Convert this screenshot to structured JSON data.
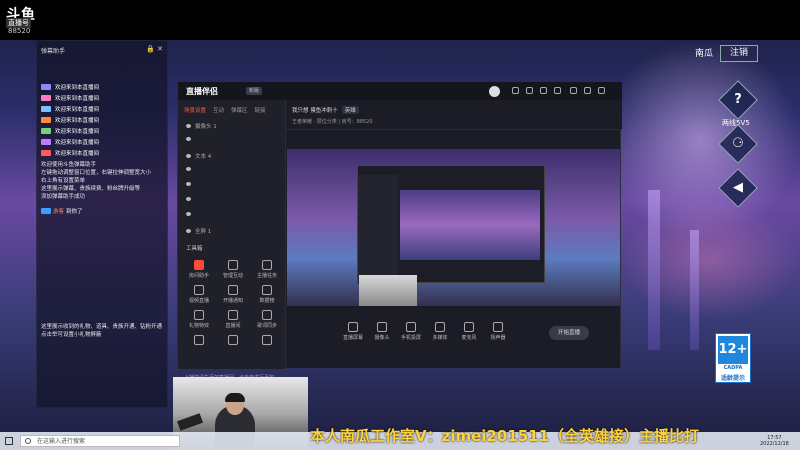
{
  "brand": {
    "logo": "斗鱼",
    "sub": "直播号",
    "room_id": "88520"
  },
  "chat": {
    "title": "弹幕助手",
    "rows": [
      {
        "tag": "#8a8aff",
        "user": "",
        "msg": "欢迎来到本直播间"
      },
      {
        "tag": "#ff7ac0",
        "user": "",
        "msg": "欢迎来到本直播间"
      },
      {
        "tag": "#7ac0ff",
        "user": "",
        "msg": "欢迎来到本直播间"
      },
      {
        "tag": "#ff8a3d",
        "user": "",
        "msg": "欢迎来到本直播间"
      },
      {
        "tag": "#7ad07a",
        "user": "",
        "msg": "欢迎来到本直播间"
      },
      {
        "tag": "#c07aff",
        "user": "",
        "msg": "欢迎来到本直播间"
      },
      {
        "tag": "#ff5a5a",
        "user": "",
        "msg": "欢迎来到本直播间"
      }
    ],
    "system": [
      "欢迎使用斗鱼弹幕助手",
      "左键拖动调整窗口位置，右键拉伸调整宽大小",
      "右上角有设置菜单",
      "这里展示弹幕、贵族续费、粉丝牌升级等",
      "添加弹幕助手成功"
    ],
    "last_user": "游客",
    "last_msg": "到你了",
    "footer": [
      "这里展示收到的礼物、道具、贵族开通、钻粉开通",
      "点击举可设置小礼物屏蔽"
    ]
  },
  "obs": {
    "title": "直播伴侣",
    "badge": "新版",
    "tabs": [
      "场景设置",
      "互动",
      "弹幕区",
      "链接"
    ],
    "sources": [
      "摄像头 1",
      "",
      "文本 4",
      "",
      "",
      "",
      "",
      "全屏 1"
    ],
    "tools_title": "工具箱",
    "tools": [
      "房间助手",
      "管理互动",
      "主播任务",
      "视频直播",
      "开播通知",
      "数据榜",
      "礼物特效",
      "直播间",
      "歌词同步",
      "",
      "",
      ""
    ],
    "warn": "上播前请先添加直播间，点击去进行添加",
    "room_title": "我只想 摸鱼冲刺十",
    "room_tag": "英雄",
    "room_sub": "王者荣耀 · 层位分类  |  房号：88520",
    "bottom": [
      "直播屏幕",
      "摄像头",
      "手机投屏",
      "多媒体",
      "麦克风",
      "扬声器"
    ],
    "go_live": "开始直播"
  },
  "right": {
    "label": "南瓜",
    "logout": "注销",
    "mode": "两线5V5"
  },
  "cadpa": {
    "age": "12+",
    "brand": "CADPA",
    "note": "适龄提示"
  },
  "scroller": "本人南瓜工作室V：zimei201511（全英雄接）主播比打",
  "taskbar": {
    "search": "在这输入进行搜索",
    "time": "17:57",
    "date": "2022/12/18"
  }
}
